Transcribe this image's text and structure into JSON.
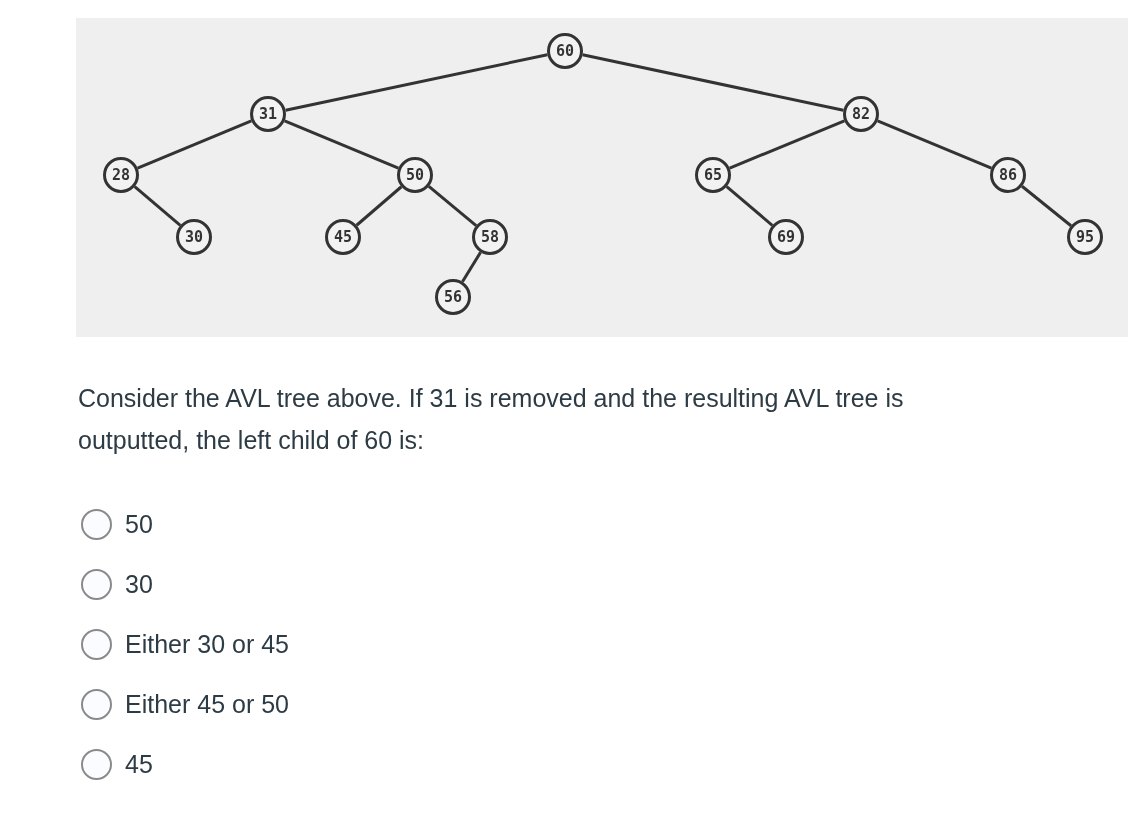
{
  "tree": {
    "value": "60",
    "left": {
      "value": "31",
      "left": {
        "value": "28",
        "right": {
          "value": "30"
        }
      },
      "right": {
        "value": "50",
        "left": {
          "value": "45"
        },
        "right": {
          "value": "58",
          "left": {
            "value": "56"
          }
        }
      }
    },
    "right": {
      "value": "82",
      "left": {
        "value": "65",
        "right": {
          "value": "69"
        }
      },
      "right": {
        "value": "86",
        "right": {
          "value": "95"
        }
      }
    }
  },
  "question": "Consider the AVL tree above. If 31 is removed and the resulting AVL tree is outputted, the left child of 60 is:",
  "options": [
    {
      "label": "50",
      "selected": false
    },
    {
      "label": "30",
      "selected": false
    },
    {
      "label": "Either 30 or 45",
      "selected": false
    },
    {
      "label": "Either 45 or 50",
      "selected": false
    },
    {
      "label": "45",
      "selected": false
    }
  ]
}
